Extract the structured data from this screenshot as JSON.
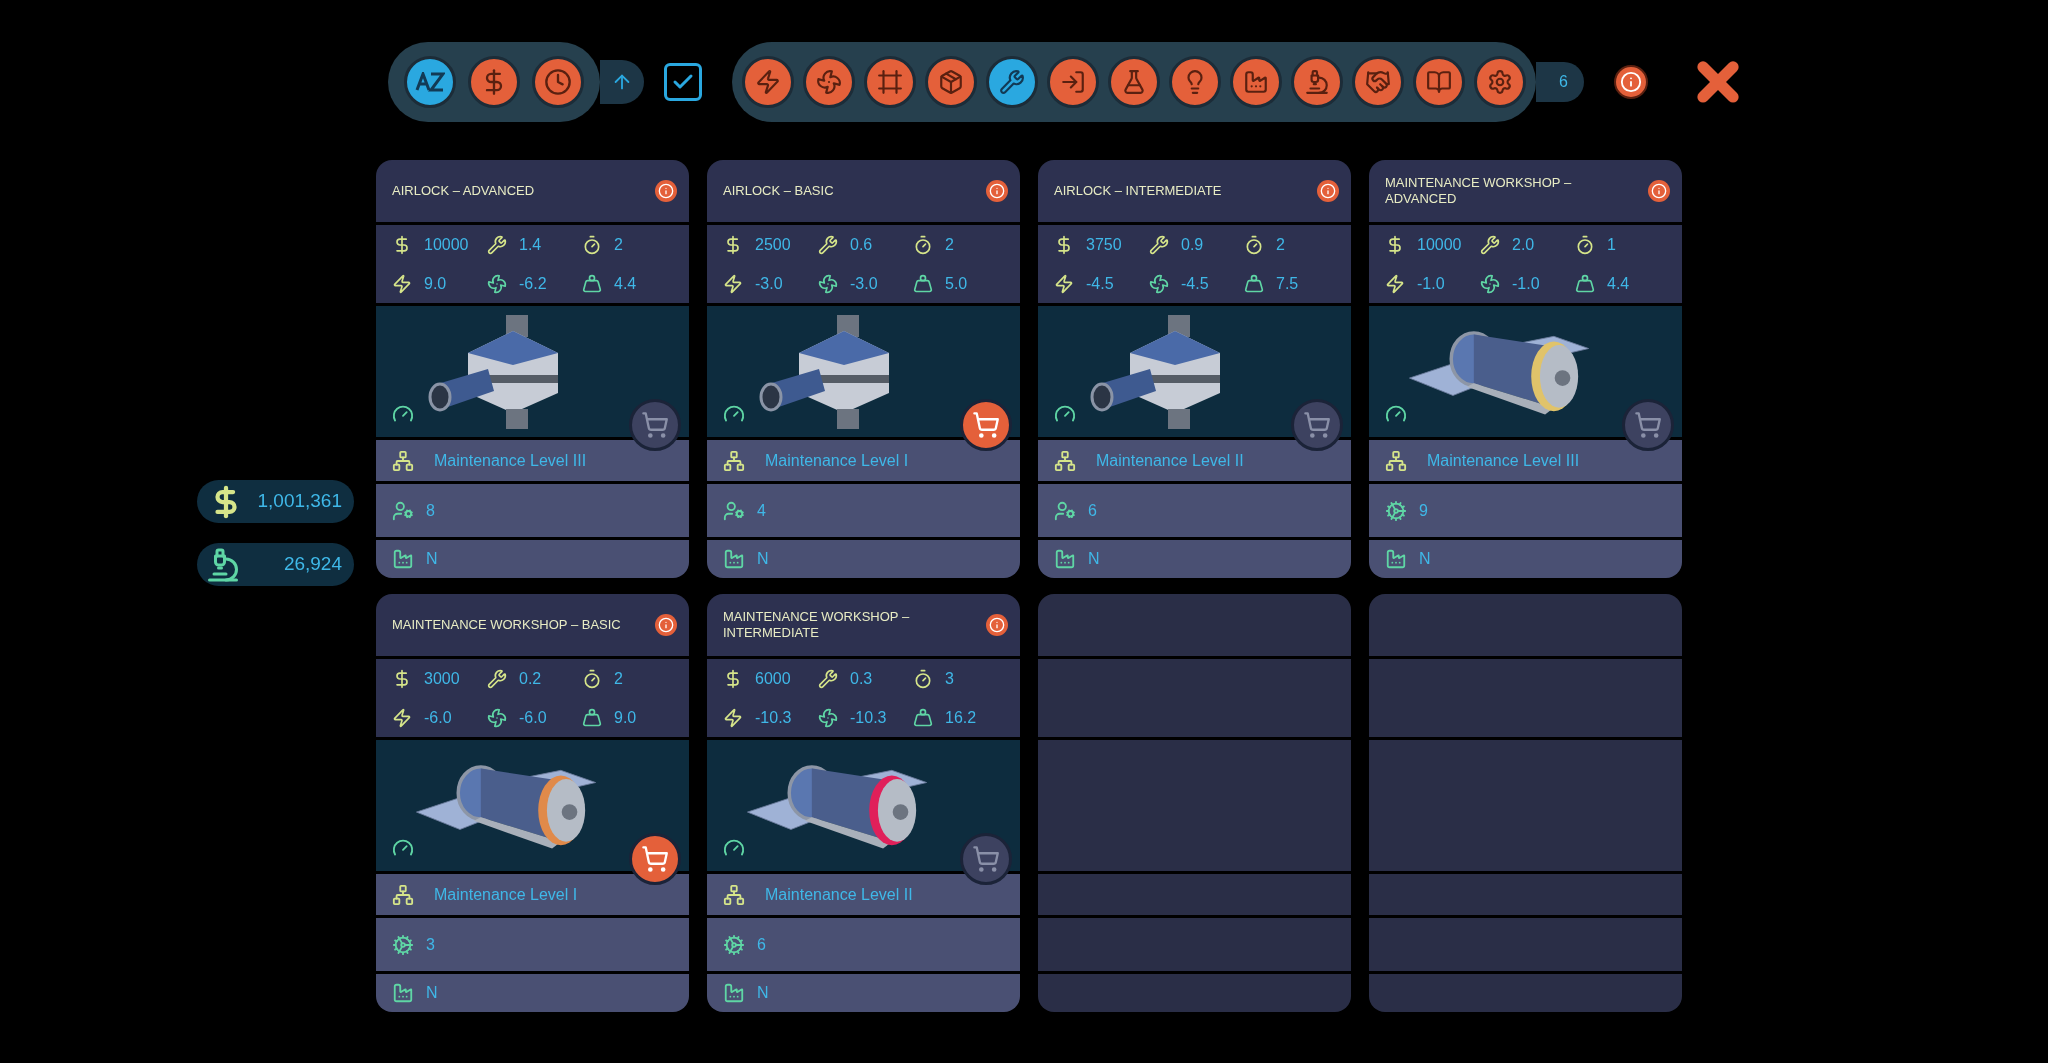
{
  "sort_buttons": [
    {
      "selected": true
    },
    {
      "selected": false
    },
    {
      "selected": false
    }
  ],
  "filter_checkbox": {
    "checked": true
  },
  "categories": [
    {
      "selected": false
    },
    {
      "selected": false
    },
    {
      "selected": false
    },
    {
      "selected": false
    },
    {
      "selected": true
    },
    {
      "selected": false
    },
    {
      "selected": false
    },
    {
      "selected": false
    },
    {
      "selected": false
    },
    {
      "selected": false
    },
    {
      "selected": false
    },
    {
      "selected": false
    },
    {
      "selected": false
    }
  ],
  "count": "6",
  "wallet": {
    "money": "1,001,361",
    "research": "26,924"
  },
  "cards": [
    {
      "kind": "airlock",
      "title": "AIRLOCK – ADVANCED",
      "stats": [
        "10000",
        "1.4",
        "2",
        "9.0",
        "-6.2",
        "4.4"
      ],
      "buy_enabled": false,
      "requirement": "Maintenance Level III",
      "count": "8",
      "made_here": "N"
    },
    {
      "kind": "airlock",
      "title": "AIRLOCK – BASIC",
      "stats": [
        "2500",
        "0.6",
        "2",
        "-3.0",
        "-3.0",
        "5.0"
      ],
      "buy_enabled": true,
      "requirement": "Maintenance Level I",
      "count": "4",
      "made_here": "N"
    },
    {
      "kind": "airlock",
      "title": "AIRLOCK – INTERMEDIATE",
      "stats": [
        "3750",
        "0.9",
        "2",
        "-4.5",
        "-4.5",
        "7.5"
      ],
      "buy_enabled": false,
      "requirement": "Maintenance Level II",
      "count": "6",
      "made_here": "N"
    },
    {
      "kind": "workshop",
      "title": "MAINTENANCE WORKSHOP – ADVANCED",
      "stats": [
        "10000",
        "2.0",
        "1",
        "-1.0",
        "-1.0",
        "4.4"
      ],
      "buy_enabled": false,
      "requirement": "Maintenance Level III",
      "count": "9",
      "made_here": "N"
    },
    {
      "kind": "workshop",
      "title": "MAINTENANCE WORKSHOP – BASIC",
      "stats": [
        "3000",
        "0.2",
        "2",
        "-6.0",
        "-6.0",
        "9.0"
      ],
      "buy_enabled": true,
      "requirement": "Maintenance Level I",
      "count": "3",
      "made_here": "N"
    },
    {
      "kind": "workshop",
      "title": "MAINTENANCE WORKSHOP – INTERMEDIATE",
      "stats": [
        "6000",
        "0.3",
        "3",
        "-10.3",
        "-10.3",
        "16.2"
      ],
      "buy_enabled": false,
      "requirement": "Maintenance Level II",
      "count": "6",
      "made_here": "N"
    },
    {
      "kind": "empty"
    },
    {
      "kind": "empty"
    }
  ]
}
